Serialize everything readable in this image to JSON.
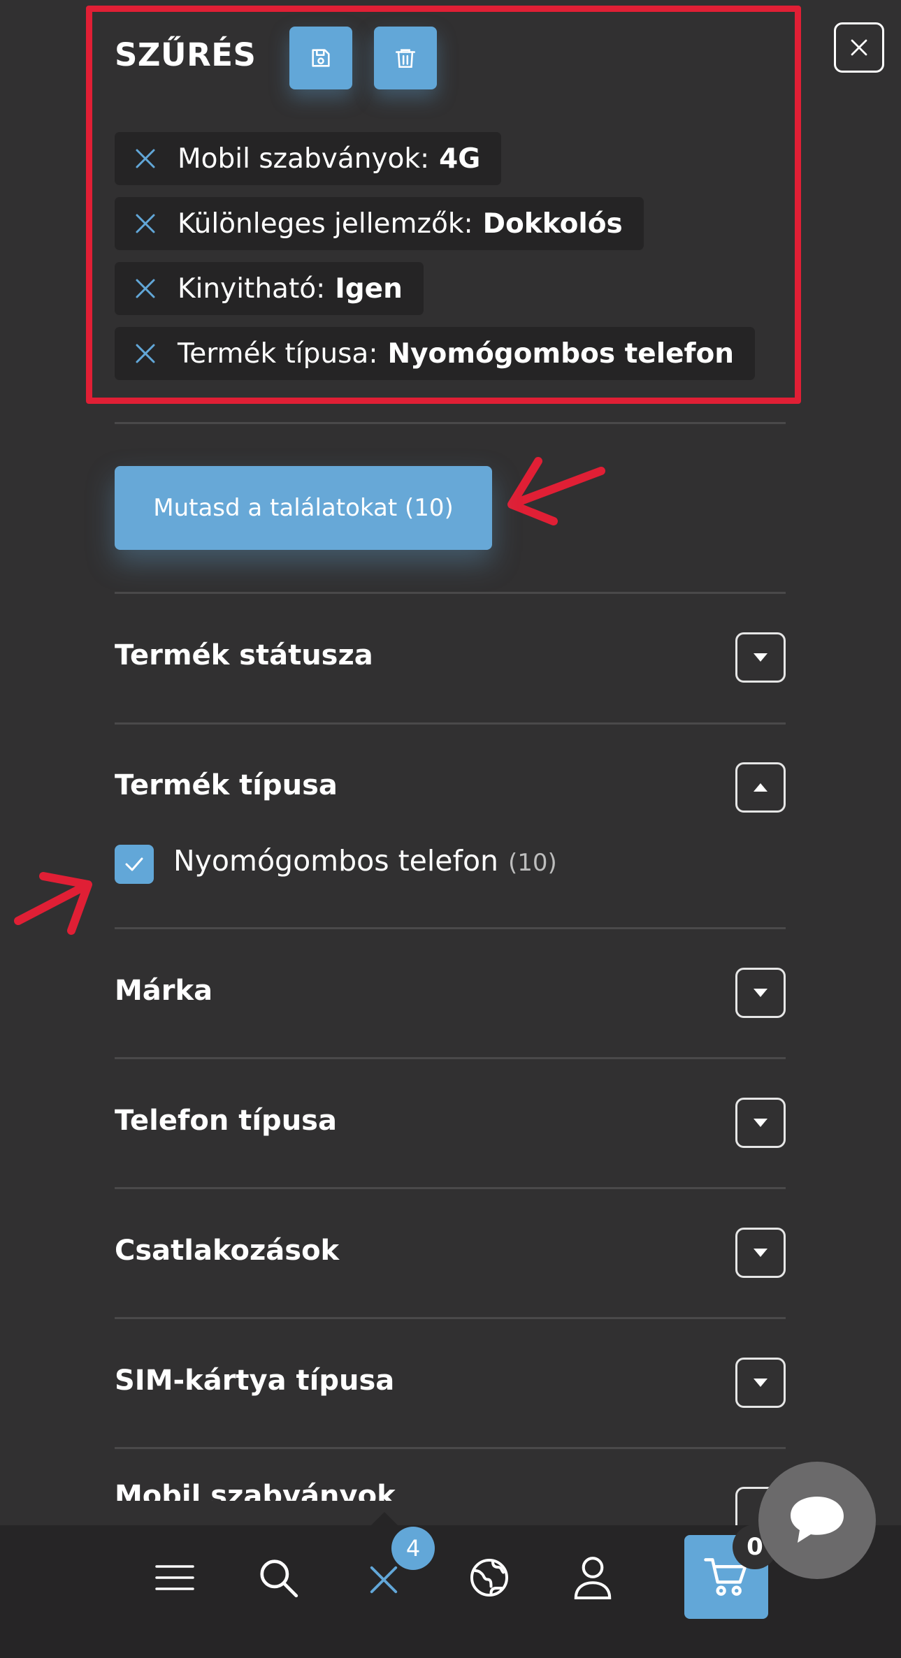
{
  "header": {
    "title": "SZŰRÉS"
  },
  "active_filters": [
    {
      "label": "Mobil szabványok:",
      "value": "4G"
    },
    {
      "label": "Különleges jellemzők:",
      "value": "Dokkolós"
    },
    {
      "label": "Kinyitható:",
      "value": "Igen"
    },
    {
      "label": "Termék típusa:",
      "value": "Nyomógombos telefon"
    }
  ],
  "results_button": {
    "label": "Mutasd a találatokat (10)"
  },
  "sections": [
    {
      "title": "Termék státusza",
      "expanded": false
    },
    {
      "title": "Termék típusa",
      "expanded": true
    },
    {
      "title": "Márka",
      "expanded": false
    },
    {
      "title": "Telefon típusa",
      "expanded": false
    },
    {
      "title": "Csatlakozások",
      "expanded": false
    },
    {
      "title": "SIM-kártya típusa",
      "expanded": false
    }
  ],
  "product_type_options": [
    {
      "label": "Nyomógombos telefon",
      "count": "(10)",
      "checked": true
    }
  ],
  "partial_section_title": "Mobil szabványok",
  "bottom_nav": {
    "filter_badge": "4",
    "cart_badge": "0",
    "icons": [
      "menu-icon",
      "search-icon",
      "clear-filter-icon",
      "globe-icon",
      "user-icon",
      "cart-icon",
      "chat-icon"
    ]
  },
  "colors": {
    "background": "#313031",
    "accent": "#62a7d8",
    "annotation": "#e01f35"
  }
}
